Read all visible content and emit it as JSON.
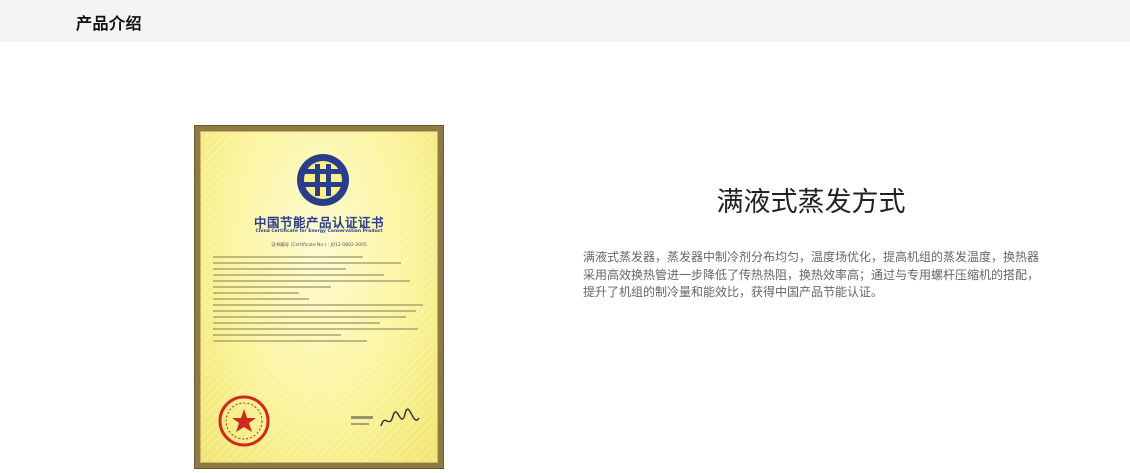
{
  "header": {
    "title": "产品介绍"
  },
  "certificate": {
    "title_cn": "中国节能产品认证证书",
    "title_en": "China Certificate for Energy Conservation Product",
    "number": "证书编号 (Certificate No.) : J012-0802-2005",
    "logo_icon": "energy-conservation-logo-icon",
    "seal_icon": "red-seal-icon",
    "signature_icon": "signature-icon"
  },
  "feature": {
    "heading": "满液式蒸发方式",
    "description": "满液式蒸发器，蒸发器中制冷剂分布均匀，温度场优化，提高机组的蒸发温度，换热器采用高效换热管进一步降低了传热热阻，换热效率高；通过与专用螺杆压缩机的搭配，提升了机组的制冷量和能效比，获得中国产品节能认证。"
  },
  "colors": {
    "header_bg": "#f4f4f4",
    "cert_frame": "#8d7a45",
    "cert_blue": "#2a3d8a",
    "seal_red": "#d0281e"
  }
}
